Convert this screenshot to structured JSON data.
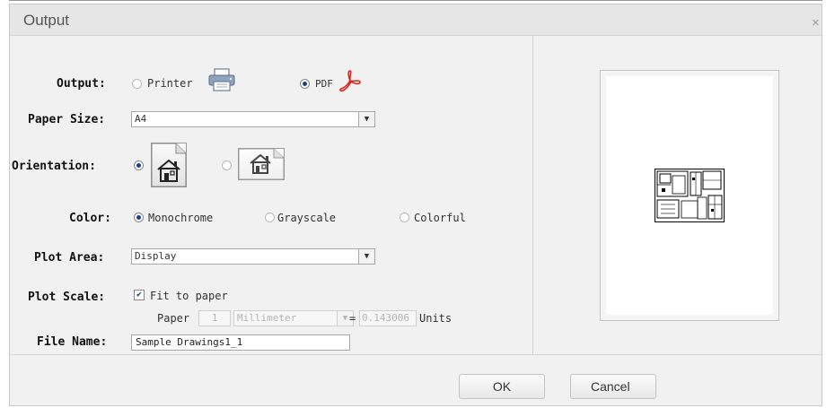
{
  "dialog": {
    "title": "Output",
    "close_glyph": "×"
  },
  "output": {
    "label": "Output:",
    "options": [
      {
        "label": "Printer",
        "icon": "printer-icon",
        "selected": false
      },
      {
        "label": "PDF",
        "icon": "pdf-icon",
        "selected": true
      }
    ]
  },
  "paper_size": {
    "label": "Paper Size:",
    "value": "A4"
  },
  "orientation": {
    "label": "Orientation:",
    "options": [
      {
        "name": "portrait",
        "icon": "portrait-house-icon",
        "selected": true
      },
      {
        "name": "landscape",
        "icon": "landscape-house-icon",
        "selected": false
      }
    ]
  },
  "color": {
    "label": "Color:",
    "options": [
      {
        "label": "Monochrome",
        "selected": true
      },
      {
        "label": "Grayscale",
        "selected": false
      },
      {
        "label": "Colorful",
        "selected": false
      }
    ]
  },
  "plot_area": {
    "label": "Plot Area:",
    "value": "Display"
  },
  "plot_scale": {
    "label": "Plot Scale:",
    "fit_label": "Fit to paper",
    "fit_checked": true,
    "paper_label": "Paper",
    "paper_value": "1",
    "unit_value": "Millimeter",
    "equals": "=",
    "units_value": "0.143006",
    "units_label": "Units"
  },
  "file_name": {
    "label": "File Name:",
    "value": "Sample Drawings1_1"
  },
  "buttons": {
    "ok": "OK",
    "cancel": "Cancel"
  },
  "colors": {
    "radio_dot": "#1c3f8c",
    "pdf_red": "#d9261c",
    "dialog_bg": "#f1f1f1"
  }
}
